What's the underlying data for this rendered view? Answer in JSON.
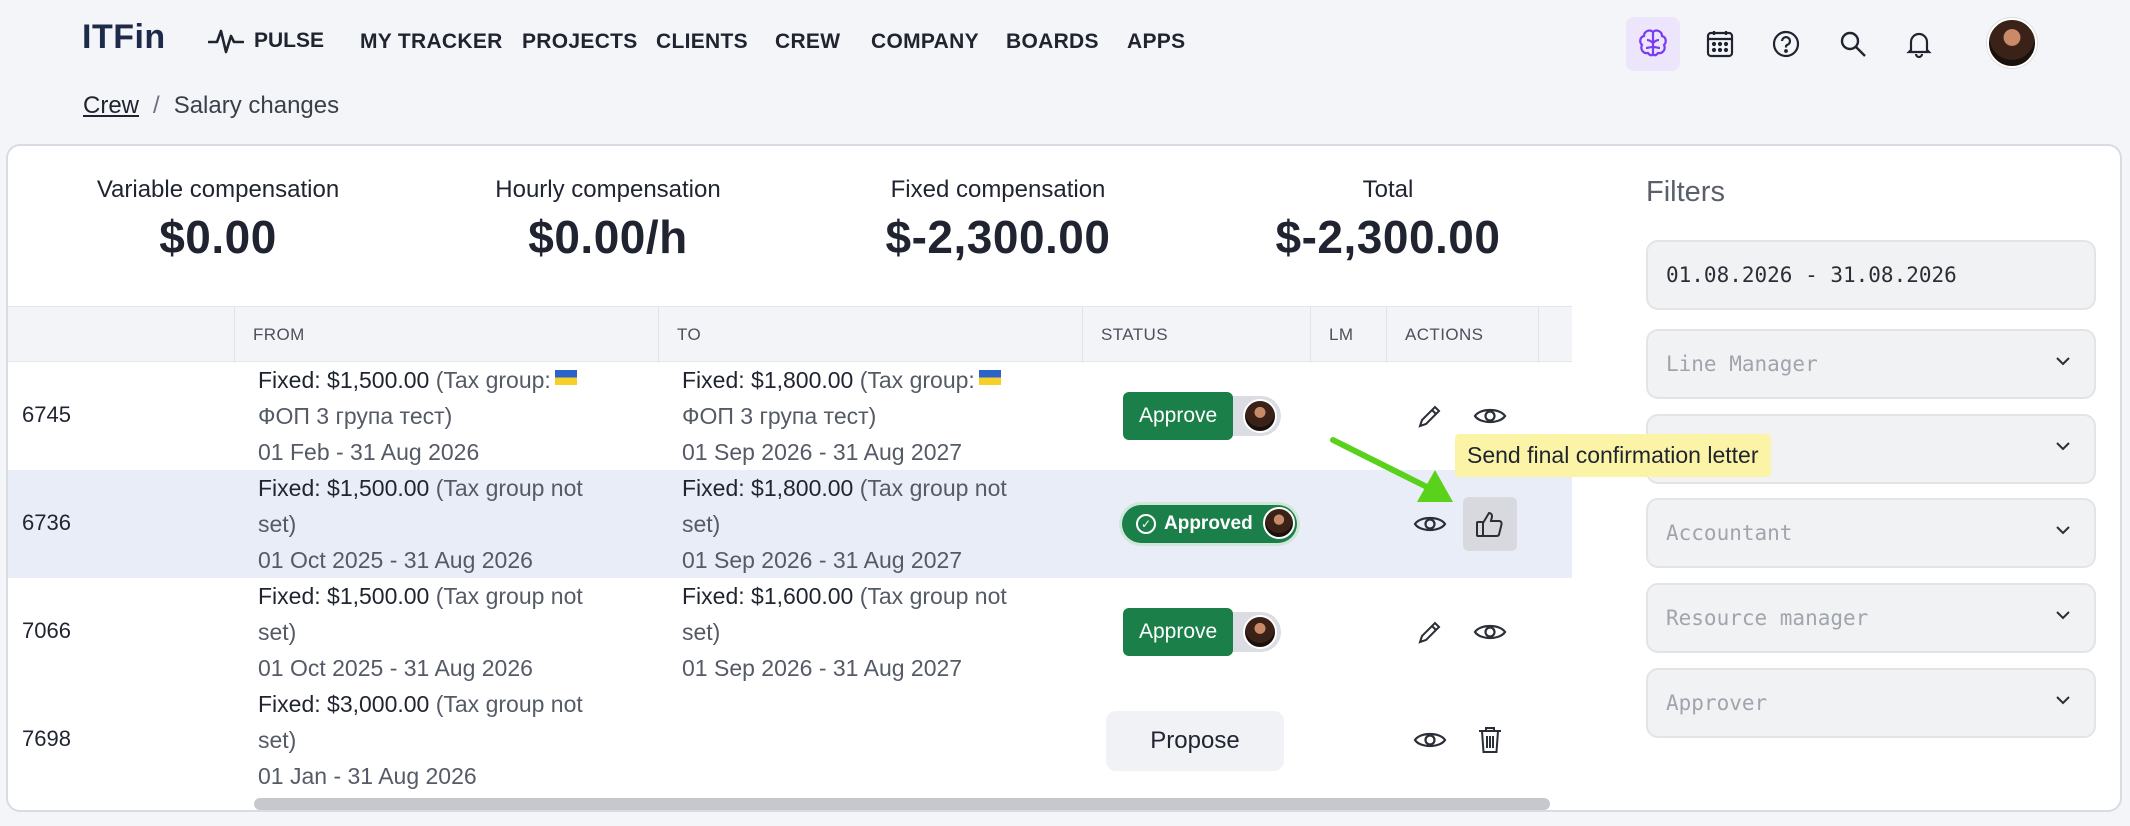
{
  "app": {
    "logo": "ITFin"
  },
  "nav": {
    "pulse": "PULSE",
    "items": [
      "MY TRACKER",
      "PROJECTS",
      "CLIENTS",
      "CREW",
      "COMPANY",
      "BOARDS",
      "APPS"
    ]
  },
  "breadcrumb": {
    "parent": "Crew",
    "separator": "/",
    "current": "Salary changes"
  },
  "summary": [
    {
      "label": "Variable compensation",
      "value": "$0.00"
    },
    {
      "label": "Hourly compensation",
      "value": "$0.00/h"
    },
    {
      "label": "Fixed compensation",
      "value": "$-2,300.00"
    },
    {
      "label": "Total",
      "value": "$-2,300.00"
    }
  ],
  "table": {
    "headers": [
      "FROM",
      "TO",
      "STATUS",
      "LM",
      "ACTIONS"
    ],
    "rows": [
      {
        "id": "6745",
        "from_amount": "Fixed: $1,500.00",
        "from_group": "(Tax group:",
        "from_group2": "ФОП 3 група тест)",
        "from_period": "01 Feb - 31 Aug 2026",
        "to_amount": "Fixed: $1,800.00",
        "to_group": "(Tax group:",
        "to_group2": "ФОП 3 група тест)",
        "to_period": "01 Sep 2026 - 31 Aug 2027",
        "status": "Approve"
      },
      {
        "id": "6736",
        "from_amount": "Fixed: $1,500.00",
        "from_group": "(Tax group not",
        "from_group2": "set)",
        "from_period": "01 Oct 2025 - 31 Aug 2026",
        "to_amount": "Fixed: $1,800.00",
        "to_group": "(Tax group not",
        "to_group2": "set)",
        "to_period": "01 Sep 2026 - 31 Aug 2027",
        "status": "Approved"
      },
      {
        "id": "7066",
        "from_amount": "Fixed: $1,500.00",
        "from_group": "(Tax group not",
        "from_group2": "set)",
        "from_period": "01 Oct 2025 - 31 Aug 2026",
        "to_amount": "Fixed: $1,600.00",
        "to_group": "(Tax group not",
        "to_group2": "set)",
        "to_period": "01 Sep 2026 - 31 Aug 2027",
        "status": "Approve"
      },
      {
        "id": "7698",
        "from_amount": "Fixed: $3,000.00",
        "from_group": "(Tax group not",
        "from_group2": "set)",
        "from_period": "01 Jan - 31 Aug 2026",
        "status": "Propose"
      }
    ]
  },
  "tooltip": "Send final confirmation letter",
  "filters": {
    "title": "Filters",
    "date_range": "01.08.2026 - 31.08.2026",
    "line_manager": "Line Manager",
    "accountant": "Accountant",
    "resource_manager": "Resource manager",
    "approver": "Approver"
  },
  "colors": {
    "approve_green": "#1b7f4a",
    "tooltip_bg": "#fbf4a6",
    "arrow_green": "#5ad11a",
    "active_icon_bg": "#ece5fb"
  }
}
